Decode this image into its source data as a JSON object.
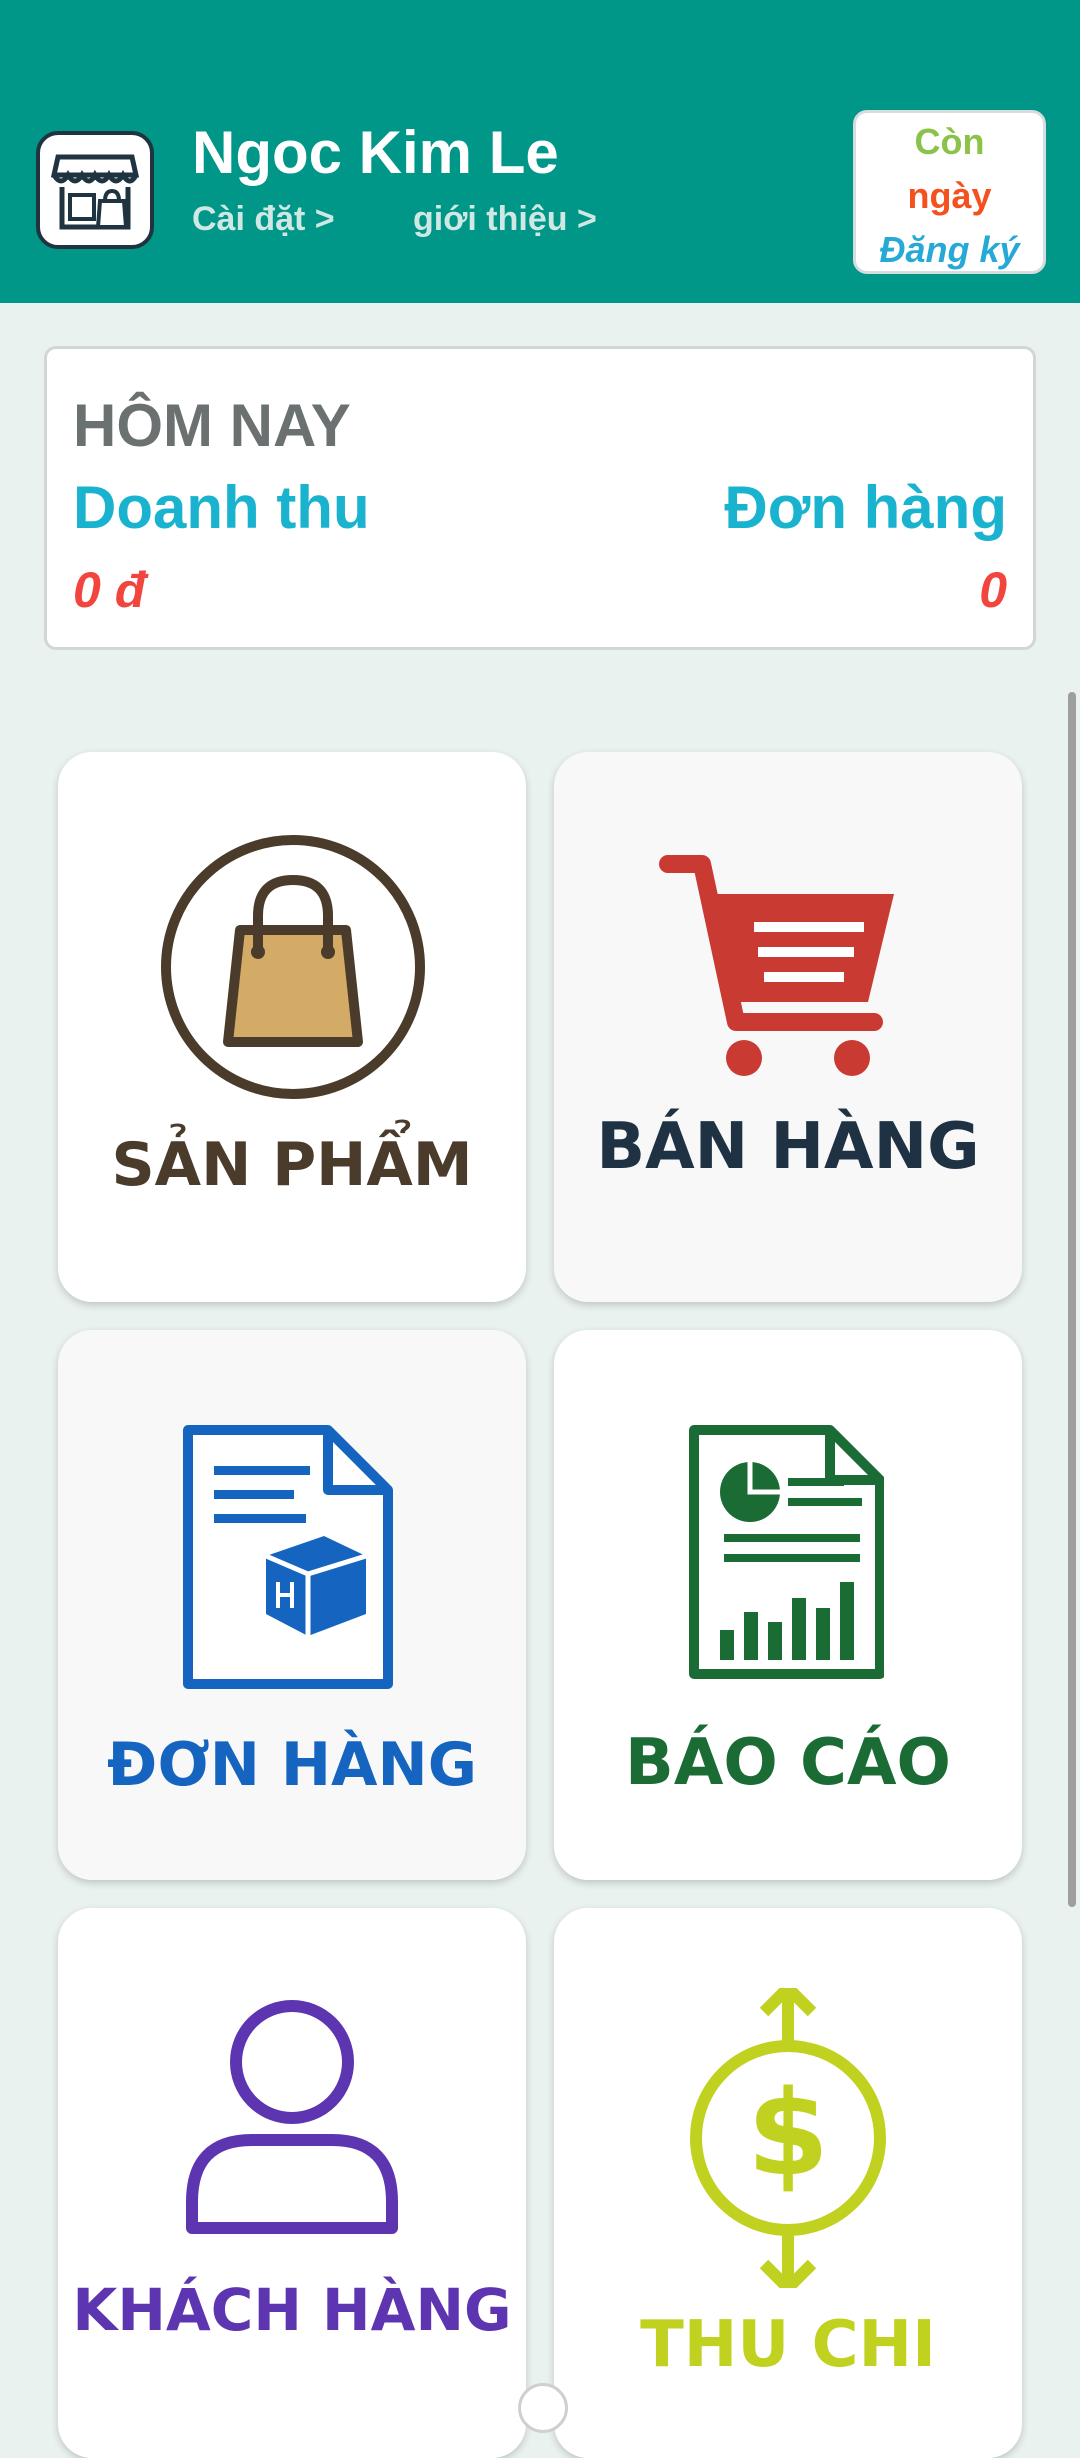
{
  "header": {
    "shop_name": "Ngoc Kim Le",
    "settings_link": "Cài đặt >",
    "about_link": "giới thiệu >",
    "logo_icon": "shop-icon",
    "subscription": {
      "line1": "Còn",
      "line2": "ngày",
      "register_label": "Đăng ký"
    }
  },
  "today": {
    "title": "HÔM NAY",
    "revenue_label": "Doanh thu",
    "revenue_value": "0 đ",
    "orders_label": "Đơn hàng",
    "orders_value": "0"
  },
  "menu": [
    {
      "label": "SẢN PHẨM",
      "icon": "shopping-bag-icon",
      "color": "#4a3b2b"
    },
    {
      "label": "BÁN HÀNG",
      "icon": "shopping-cart-icon",
      "color": "#1f3244"
    },
    {
      "label": "ĐƠN HÀNG",
      "icon": "order-document-icon",
      "color": "#1565c0"
    },
    {
      "label": "BÁO CÁO",
      "icon": "report-document-icon",
      "color": "#1b6b35"
    },
    {
      "label": "KHÁCH HÀNG",
      "icon": "customer-icon",
      "color": "#5e35b1"
    },
    {
      "label": "THU CHI",
      "icon": "dollar-icon",
      "color": "#c0d21f"
    }
  ],
  "colors": {
    "header_bg": "#009688",
    "page_bg": "#e9f2ee",
    "accent_text": "#1ab3cf",
    "value_text": "#f2453d"
  }
}
